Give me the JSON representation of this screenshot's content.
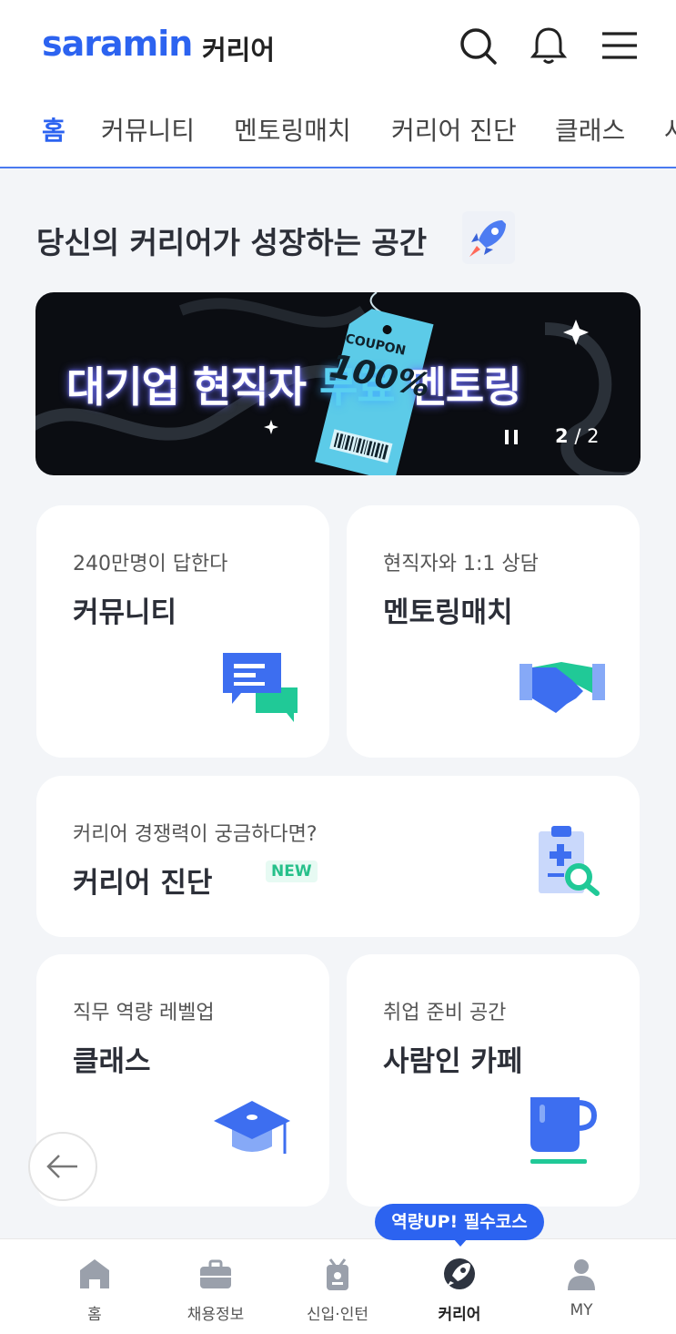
{
  "header": {
    "logo": "saramin",
    "logo_sub": "커리어",
    "icons": [
      "search-icon",
      "bell-icon",
      "menu-icon"
    ]
  },
  "tabs": [
    {
      "label": "홈",
      "active": true
    },
    {
      "label": "커뮤니티",
      "active": false
    },
    {
      "label": "멘토링매치",
      "active": false
    },
    {
      "label": "커리어 진단",
      "active": false
    },
    {
      "label": "클래스",
      "active": false
    },
    {
      "label": "사",
      "active": false
    }
  ],
  "page_title": "당신의 커리어가 성장하는 공간",
  "banner": {
    "text_part1": "대기업 현직자 ",
    "text_accent": "무료",
    "text_part2": " 멘토링",
    "coupon_label": "COUPON",
    "coupon_value": "100%",
    "pager_current": "2",
    "pager_total": "/ 2"
  },
  "cards": {
    "community": {
      "sub": "240만명이 답한다",
      "title": "커뮤니티",
      "icon": "chat-bubbles-icon"
    },
    "mentoring": {
      "sub": "현직자와 1:1 상담",
      "title": "멘토링매치",
      "icon": "handshake-icon"
    },
    "diagnosis": {
      "sub": "커리어 경쟁력이 궁금하다면?",
      "title": "커리어 진단",
      "badge": "NEW",
      "icon": "clipboard-search-icon"
    },
    "class": {
      "sub": "직무 역량 레벨업",
      "title": "클래스",
      "icon": "graduation-cap-icon"
    },
    "cafe": {
      "sub": "취업 준비 공간",
      "title": "사람인 카페",
      "icon": "coffee-cup-icon"
    }
  },
  "tooltip": "역량UP! 필수코스",
  "bottom_nav": [
    {
      "label": "홈",
      "icon": "home-icon",
      "active": false
    },
    {
      "label": "채용정보",
      "icon": "briefcase-icon",
      "active": false
    },
    {
      "label": "신입·인턴",
      "icon": "badge-icon",
      "active": false
    },
    {
      "label": "커리어",
      "icon": "rocket-icon",
      "active": true
    },
    {
      "label": "MY",
      "icon": "person-icon",
      "active": false
    }
  ],
  "colors": {
    "brand": "#2c63f0",
    "background": "#f3f5f8",
    "accent_green": "#26c08a"
  }
}
